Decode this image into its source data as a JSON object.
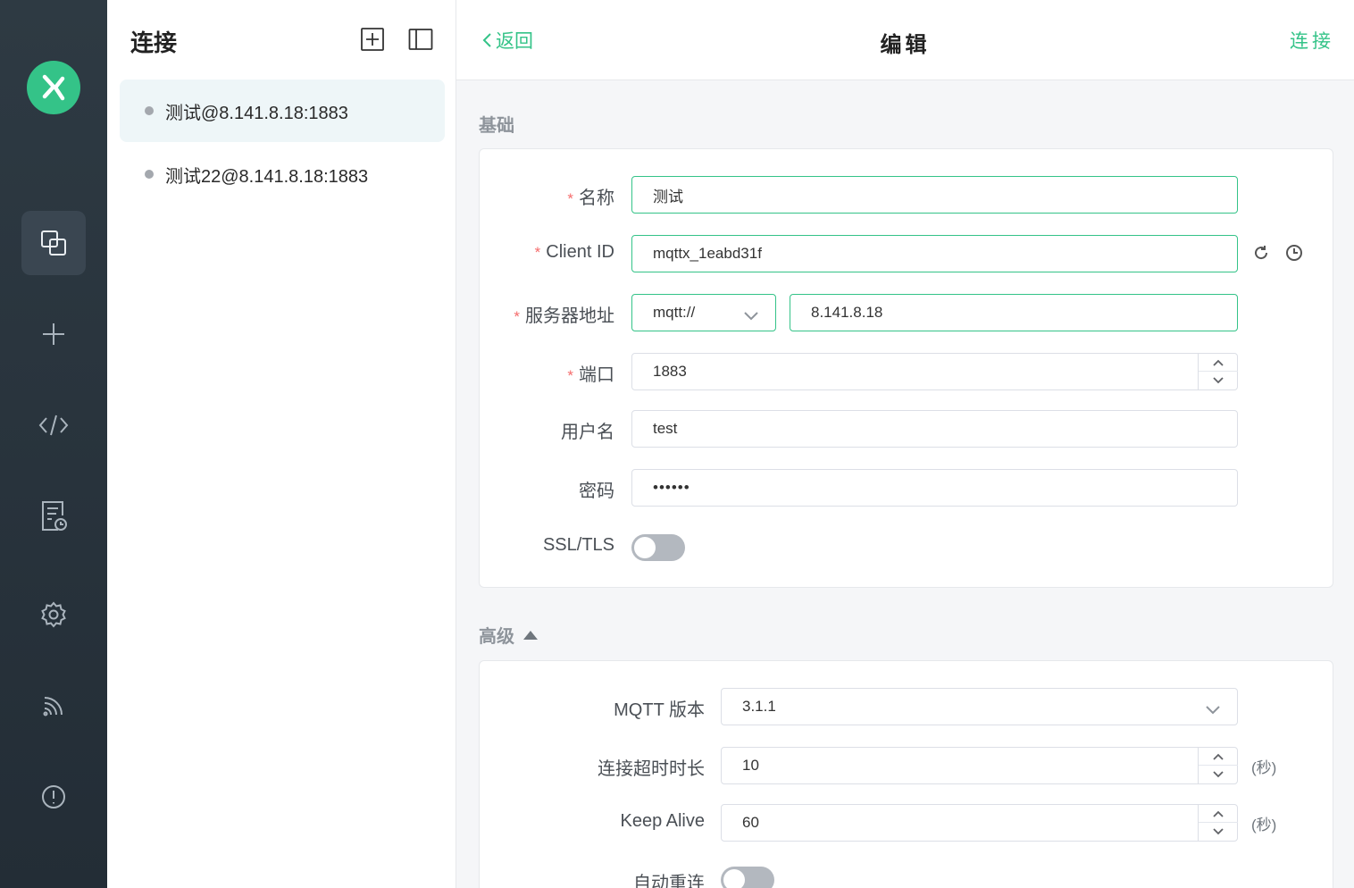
{
  "sidebar": {
    "logo": "mqttx-logo",
    "icons": [
      "connections-icon",
      "plus-icon",
      "code-icon",
      "log-icon",
      "gear-icon",
      "feed-icon",
      "info-icon"
    ]
  },
  "connections_panel": {
    "title": "连接",
    "items": [
      {
        "label": "测试@8.141.8.18:1883",
        "active": true
      },
      {
        "label": "测试22@8.141.8.18:1883",
        "active": false
      }
    ]
  },
  "header": {
    "back_label": "返回",
    "title": "编辑",
    "connect_label": "连接"
  },
  "basic": {
    "section_title": "基础",
    "name_label": "名称",
    "name_value": "测试",
    "client_id_label": "Client ID",
    "client_id_value": "mqttx_1eabd31f",
    "host_label": "服务器地址",
    "protocol_value": "mqtt://",
    "host_value": "8.141.8.18",
    "port_label": "端口",
    "port_value": "1883",
    "username_label": "用户名",
    "username_value": "test",
    "password_label": "密码",
    "password_value": "••••••",
    "ssl_label": "SSL/TLS",
    "ssl_enabled": false
  },
  "advanced": {
    "section_title": "高级",
    "mqtt_version_label": "MQTT 版本",
    "mqtt_version_value": "3.1.1",
    "timeout_label": "连接超时时长",
    "timeout_value": "10",
    "timeout_unit": "(秒)",
    "keepalive_label": "Keep Alive",
    "keepalive_value": "60",
    "keepalive_unit": "(秒)",
    "reconnect_label": "自动重连",
    "reconnect_enabled": false
  },
  "colors": {
    "accent": "#34c388",
    "rail_bg": "#2a353e",
    "required": "#f56c6c"
  }
}
